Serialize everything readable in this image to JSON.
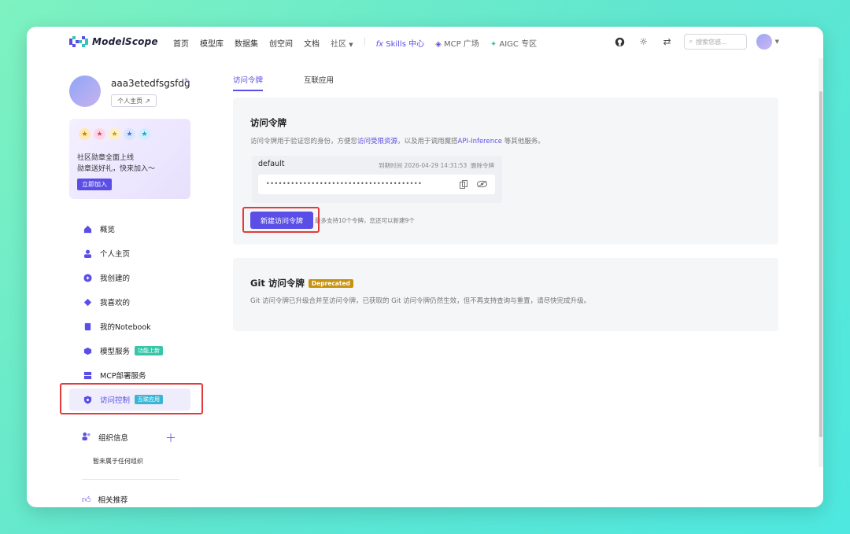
{
  "colors": {
    "accent": "#5b4ee6",
    "highlight": "#e23b3b",
    "teal_tag": "#38c5a8",
    "deprecated_tag": "#c7920f"
  },
  "nav": {
    "logo": "ModelScope",
    "items": [
      "首页",
      "模型库",
      "数据集",
      "创空间",
      "文档",
      "社区"
    ],
    "skills": "Skills 中心",
    "mcp": "MCP 广场",
    "aigc": "AIGC 专区",
    "search_placeholder": "搜索您感...",
    "icons": [
      "github-icon",
      "theme-toggle-icon",
      "translate-icon"
    ]
  },
  "profile": {
    "username": "aaa3etedfsgsfdg",
    "home_link": "个人主页"
  },
  "badge_card": {
    "line1": "社区勋章全面上线",
    "line2": "勋章送好礼，快来加入～",
    "join_button": "立即加入"
  },
  "sidebar": {
    "items": [
      {
        "label": "概览",
        "icon": "home-icon"
      },
      {
        "label": "个人主页",
        "icon": "user-icon"
      },
      {
        "label": "我创建的",
        "icon": "create-icon"
      },
      {
        "label": "我喜欢的",
        "icon": "favorite-icon"
      },
      {
        "label": "我的Notebook",
        "icon": "notebook-icon"
      },
      {
        "label": "模型服务",
        "icon": "cube-icon",
        "tag": "功能上新"
      },
      {
        "label": "MCP部署服务",
        "icon": "server-icon"
      },
      {
        "label": "访问控制",
        "icon": "shield-icon",
        "tag": "互联应用"
      }
    ],
    "org_title": "组织信息",
    "org_empty": "暂未属于任何组织",
    "recommend": "相关推荐"
  },
  "tabs": [
    "访问令牌",
    "互联应用"
  ],
  "access_token": {
    "title": "访问令牌",
    "desc_prefix": "访问令牌用于验证您的身份，方便您",
    "desc_link1": "访问受限资源",
    "desc_mid": "，以及用于调用魔搭",
    "desc_link2": "API-Inference",
    "desc_suffix": "等其他服务。",
    "token_name": "default",
    "expiry": "到期时间 2026-04-29 14:31:53",
    "delete": "删除令牌",
    "masked": "••••••••••••••••••••••••••••••••••••••",
    "new_button": "新建访问令牌",
    "limit": "最多支持10个令牌，您还可以新建9个"
  },
  "git_token": {
    "title": "Git 访问令牌",
    "tag": "Deprecated",
    "desc": "Git 访问令牌已升级合并至访问令牌，已获取的 Git 访问令牌仍然生效，但不再支持查询与重置，请尽快完成升级。"
  }
}
